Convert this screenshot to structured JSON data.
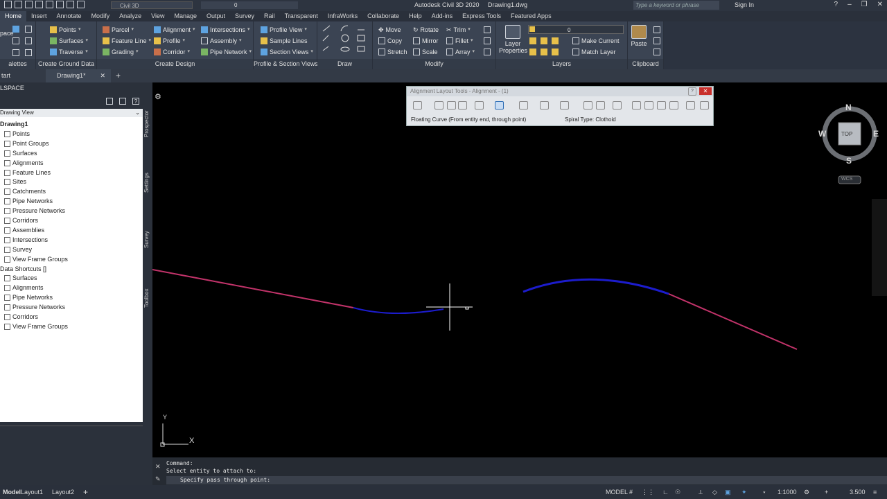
{
  "titlebar": {
    "workspace": "Civil 3D",
    "layer": "0",
    "app_title": "Autodesk Civil 3D 2020",
    "file_title": "Drawing1.dwg",
    "search_placeholder": "Type a keyword or phrase",
    "sign_in": "Sign In"
  },
  "tabs": [
    "Home",
    "Insert",
    "Annotate",
    "Modify",
    "Analyze",
    "View",
    "Manage",
    "Output",
    "Survey",
    "Rail",
    "Transparent",
    "InfraWorks",
    "Collaborate",
    "Help",
    "Add-ins",
    "Express Tools",
    "Featured Apps"
  ],
  "ribbon": {
    "palettes": {
      "title": "alettes",
      "left_label": "pace"
    },
    "ground": {
      "title": "Create Ground Data",
      "points": "Points",
      "surfaces": "Surfaces",
      "traverse": "Traverse"
    },
    "design": {
      "title": "Create Design",
      "parcel": "Parcel",
      "feature_line": "Feature Line",
      "grading": "Grading",
      "alignment": "Alignment",
      "profile": "Profile",
      "corridor": "Corridor",
      "intersections": "Intersections",
      "assembly": "Assembly",
      "pipe_network": "Pipe Network"
    },
    "profile_section": {
      "title": "Profile & Section Views",
      "profile_view": "Profile View",
      "sample_lines": "Sample Lines",
      "section_views": "Section Views"
    },
    "draw": {
      "title": "Draw"
    },
    "modify": {
      "title": "Modify",
      "move": "Move",
      "copy": "Copy",
      "stretch": "Stretch",
      "rotate": "Rotate",
      "mirror": "Mirror",
      "scale": "Scale",
      "trim": "Trim",
      "fillet": "Fillet",
      "array": "Array"
    },
    "layers": {
      "title": "Layers",
      "layer_properties": "Layer\nProperties",
      "layer_value": "0",
      "make_current": "Make Current",
      "match_layer": "Match Layer"
    },
    "clipboard": {
      "title": "Clipboard",
      "paste": "Paste"
    }
  },
  "filetabs": {
    "start": "tart",
    "drawing": "Drawing1*"
  },
  "toolspace": {
    "title": "LSPACE",
    "view": "Drawing View",
    "tree": [
      {
        "label": "Drawing1",
        "indent": 0,
        "bold": true
      },
      {
        "label": "Points",
        "indent": 1
      },
      {
        "label": "Point Groups",
        "indent": 1
      },
      {
        "label": "Surfaces",
        "indent": 1
      },
      {
        "label": "Alignments",
        "indent": 1
      },
      {
        "label": "Feature Lines",
        "indent": 1
      },
      {
        "label": "Sites",
        "indent": 1
      },
      {
        "label": "Catchments",
        "indent": 1
      },
      {
        "label": "Pipe Networks",
        "indent": 1
      },
      {
        "label": "Pressure Networks",
        "indent": 1
      },
      {
        "label": "Corridors",
        "indent": 1
      },
      {
        "label": "Assemblies",
        "indent": 1
      },
      {
        "label": "Intersections",
        "indent": 1
      },
      {
        "label": "Survey",
        "indent": 1
      },
      {
        "label": "View Frame Groups",
        "indent": 1
      },
      {
        "label": "Data Shortcuts []",
        "indent": 0
      },
      {
        "label": "Surfaces",
        "indent": 1
      },
      {
        "label": "Alignments",
        "indent": 1
      },
      {
        "label": "Pipe Networks",
        "indent": 1
      },
      {
        "label": "Pressure Networks",
        "indent": 1
      },
      {
        "label": "Corridors",
        "indent": 1
      },
      {
        "label": "View Frame Groups",
        "indent": 1
      }
    ],
    "side_tabs": [
      "Prospector",
      "Settings",
      "Survey",
      "Toolbox"
    ]
  },
  "alignment_tools": {
    "title": "Alignment Layout Tools - Alignment - (1)",
    "status_left": "Floating Curve (From entity end, through point)",
    "status_right": "Spiral Type: Clothoid"
  },
  "viewcube": {
    "north": "N",
    "south": "S",
    "east": "E",
    "west": "W",
    "top": "TOP",
    "wcs": "WCS"
  },
  "ucs": {
    "x": "X",
    "y": "Y"
  },
  "command": {
    "line1": "Command:",
    "line2": "Select entity to attach to:",
    "prompt": "Specify pass through point:"
  },
  "status": {
    "tabs": [
      "Model",
      "Layout1",
      "Layout2"
    ],
    "model": "MODEL",
    "scale": "1:1000",
    "value": "3.500"
  },
  "colors": {
    "tangent": "#c2336a",
    "curve": "#1c1ccc",
    "accent": "#5ea3e0"
  }
}
